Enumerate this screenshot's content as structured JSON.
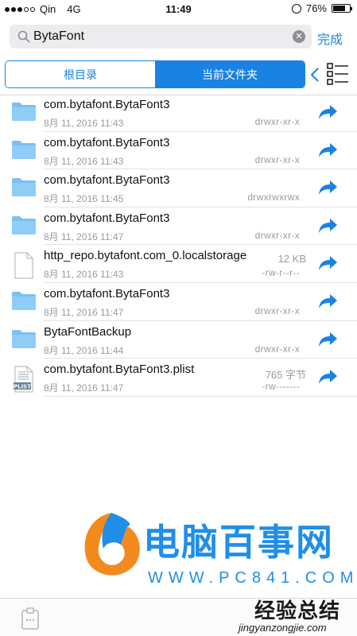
{
  "status_bar": {
    "carrier": "Qin",
    "network": "4G",
    "time": "11:49",
    "battery": "76%",
    "battery_level": 0.76
  },
  "search": {
    "value": "BytaFont",
    "done_label": "完成"
  },
  "segments": {
    "root": "根目录",
    "current": "当前文件夹"
  },
  "files": [
    {
      "name": "com.bytafont.BytaFont3",
      "date": "8月 11, 2016 11:43",
      "perm": "drwxr-xr-x",
      "size": "",
      "type": "folder"
    },
    {
      "name": "com.bytafont.BytaFont3",
      "date": "8月 11, 2016 11:43",
      "perm": "drwxr-xr-x",
      "size": "",
      "type": "folder"
    },
    {
      "name": "com.bytafont.BytaFont3",
      "date": "8月 11, 2016 11:45",
      "perm": "drwxrwxrwx",
      "size": "",
      "type": "folder"
    },
    {
      "name": "com.bytafont.BytaFont3",
      "date": "8月 11, 2016 11:47",
      "perm": "drwxr-xr-x",
      "size": "",
      "type": "folder"
    },
    {
      "name": "http_repo.bytafont.com_0.localstorage",
      "date": "8月 11, 2016 11:43",
      "perm": "-rw-r--r--",
      "size": "12 KB",
      "type": "file"
    },
    {
      "name": "com.bytafont.BytaFont3",
      "date": "8月 11, 2016 11:47",
      "perm": "drwxr-xr-x",
      "size": "",
      "type": "folder"
    },
    {
      "name": "BytaFontBackup",
      "date": "8月 11, 2016 11:44",
      "perm": "drwxr-xr-x",
      "size": "",
      "type": "folder"
    },
    {
      "name": "com.bytafont.BytaFont3.plist",
      "date": "8月 11, 2016 11:47",
      "perm": "-rw-------",
      "size": "765 字节",
      "type": "plist"
    }
  ],
  "plist_label": "PLIST",
  "watermark": {
    "brand": "电脑百事网",
    "url": "WWW.PC841.COM",
    "corner_title": "经验总结",
    "corner_url": "jingyanzongjie.com"
  },
  "colors": {
    "accent": "#1a82e2",
    "folder": "#79c1f2"
  }
}
